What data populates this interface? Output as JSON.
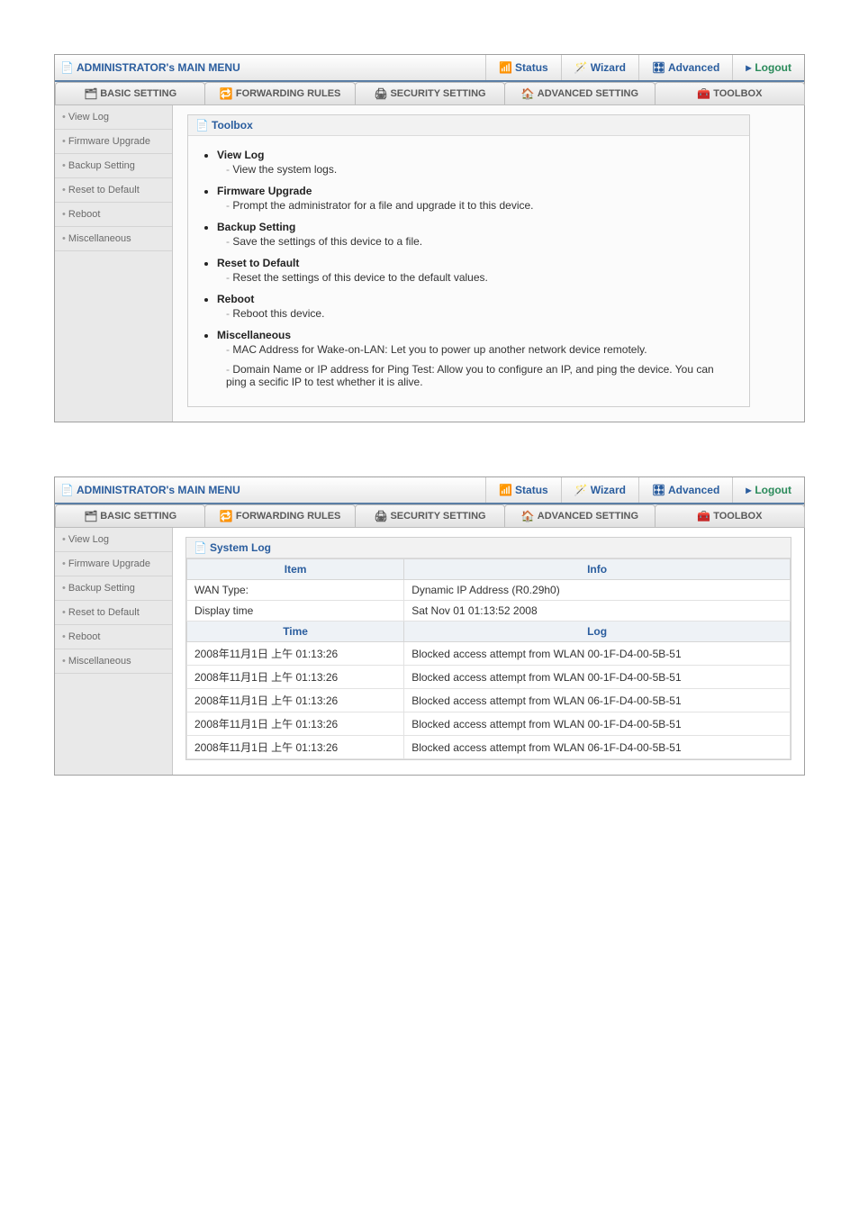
{
  "topbar": {
    "title": "ADMINISTRATOR's MAIN MENU",
    "status": "Status",
    "wizard": "Wizard",
    "advanced": "Advanced",
    "logout": "Logout"
  },
  "tabs": {
    "basic": "BASIC SETTING",
    "forwarding": "FORWARDING RULES",
    "security": "SECURITY SETTING",
    "advanced": "ADVANCED SETTING",
    "toolbox": "TOOLBOX"
  },
  "sidebar": {
    "view_log": "View Log",
    "firmware": "Firmware Upgrade",
    "backup": "Backup Setting",
    "reset": "Reset to Default",
    "reboot": "Reboot",
    "misc": "Miscellaneous"
  },
  "toolbox": {
    "title": "Toolbox",
    "view_log": {
      "title": "View Log",
      "desc": "View the system logs."
    },
    "firmware": {
      "title": "Firmware Upgrade",
      "desc": "Prompt the administrator for a file and upgrade it to this device."
    },
    "backup": {
      "title": "Backup Setting",
      "desc": "Save the settings of this device to a file."
    },
    "reset": {
      "title": "Reset to Default",
      "desc": "Reset the settings of this device to the default values."
    },
    "reboot": {
      "title": "Reboot",
      "desc": "Reboot this device."
    },
    "misc": {
      "title": "Miscellaneous",
      "desc1": "MAC Address for Wake-on-LAN: Let you to power up another network device remotely.",
      "desc2": "Domain Name or IP address for Ping Test: Allow you to configure an IP, and ping the device. You can ping a secific IP to test whether it is alive."
    }
  },
  "syslog": {
    "title": "System Log",
    "col_item": "Item",
    "col_info": "Info",
    "col_time": "Time",
    "col_log": "Log",
    "rows_info": [
      {
        "k": "WAN Type:",
        "v": "Dynamic IP Address (R0.29h0)"
      },
      {
        "k": "Display time",
        "v": "Sat Nov 01 01:13:52 2008"
      }
    ],
    "rows_log": [
      {
        "t": "2008年11月1日 上午 01:13:26",
        "m": "Blocked access attempt from WLAN 00-1F-D4-00-5B-51"
      },
      {
        "t": "2008年11月1日 上午 01:13:26",
        "m": "Blocked access attempt from WLAN 00-1F-D4-00-5B-51"
      },
      {
        "t": "2008年11月1日 上午 01:13:26",
        "m": "Blocked access attempt from WLAN 06-1F-D4-00-5B-51"
      },
      {
        "t": "2008年11月1日 上午 01:13:26",
        "m": "Blocked access attempt from WLAN 00-1F-D4-00-5B-51"
      },
      {
        "t": "2008年11月1日 上午 01:13:26",
        "m": "Blocked access attempt from WLAN 06-1F-D4-00-5B-51"
      }
    ]
  }
}
